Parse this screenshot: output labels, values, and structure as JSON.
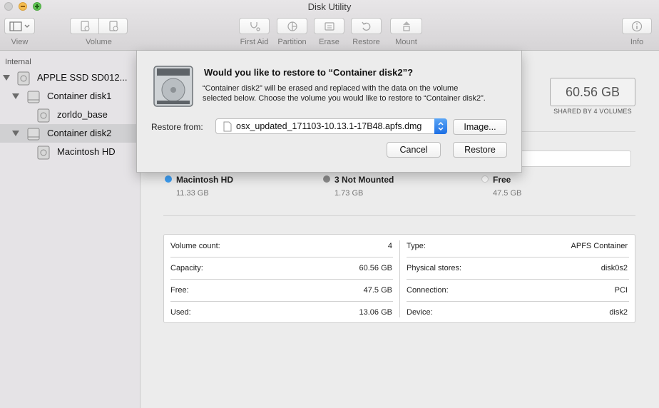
{
  "window": {
    "title": "Disk Utility"
  },
  "toolbar": {
    "view_label": "View",
    "volume_label": "Volume",
    "first_aid_label": "First Aid",
    "partition_label": "Partition",
    "erase_label": "Erase",
    "restore_label": "Restore",
    "mount_label": "Mount",
    "info_label": "Info"
  },
  "sidebar": {
    "section": "Internal",
    "items": [
      {
        "label": "APPLE SSD SD012...",
        "icon": "hard-disk-icon"
      },
      {
        "label": "Container disk1",
        "icon": "container-icon"
      },
      {
        "label": "zorldo_base",
        "icon": "volume-icon"
      },
      {
        "label": "Container disk2",
        "icon": "container-icon",
        "selected": true
      },
      {
        "label": "Macintosh HD",
        "icon": "volume-icon"
      }
    ]
  },
  "summary": {
    "capacity": "60.56 GB",
    "shared_note": "SHARED BY 4 VOLUMES",
    "legend": [
      {
        "name": "Macintosh HD",
        "size": "11.33 GB",
        "color": "#3d9ef3"
      },
      {
        "name": "3 Not Mounted",
        "size": "1.73 GB",
        "color": "#8c8c8c"
      },
      {
        "name": "Free",
        "size": "47.5 GB",
        "color": "#ffffff"
      }
    ]
  },
  "info": {
    "left": [
      {
        "label": "Volume count:",
        "value": "4"
      },
      {
        "label": "Capacity:",
        "value": "60.56 GB"
      },
      {
        "label": "Free:",
        "value": "47.5 GB"
      },
      {
        "label": "Used:",
        "value": "13.06 GB"
      }
    ],
    "right": [
      {
        "label": "Type:",
        "value": "APFS Container"
      },
      {
        "label": "Physical stores:",
        "value": "disk0s2"
      },
      {
        "label": "Connection:",
        "value": "PCI"
      },
      {
        "label": "Device:",
        "value": "disk2"
      }
    ]
  },
  "dialog": {
    "title": "Would you like to restore to “Container disk2”?",
    "message": "“Container disk2” will be erased and replaced with the data on the volume selected below. Choose the volume you would like to restore to “Container disk2”.",
    "restore_from_label": "Restore from:",
    "selected_image": "osx_updated_171103-10.13.1-17B48.apfs.dmg",
    "image_button": "Image...",
    "cancel_button": "Cancel",
    "restore_button": "Restore"
  }
}
